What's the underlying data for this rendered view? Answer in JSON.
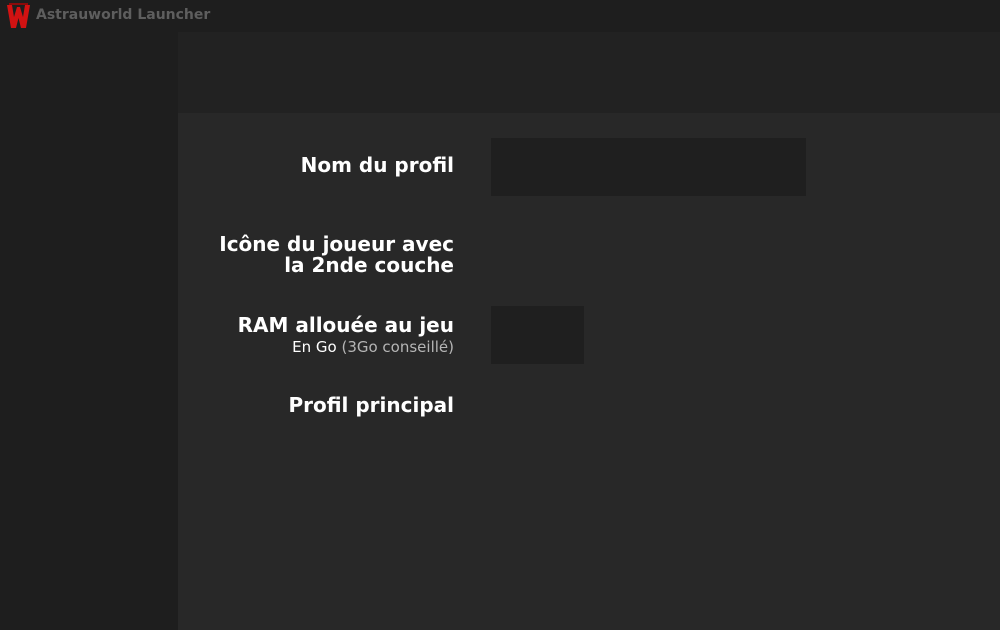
{
  "app": {
    "title": "Astrauworld Launcher",
    "logo_icon": "astrauworld-logo-icon",
    "accent_color": "#d21212"
  },
  "profile_form": {
    "name": {
      "label": "Nom du profil",
      "value": ""
    },
    "player_icon": {
      "label_line1": "Icône du joueur avec",
      "label_line2": "la 2nde couche"
    },
    "ram": {
      "label": "RAM allouée au jeu",
      "unit_text": "En Go",
      "hint_text": "(3Go conseillé)",
      "value": ""
    },
    "main_profile": {
      "label": "Profil principal"
    }
  }
}
